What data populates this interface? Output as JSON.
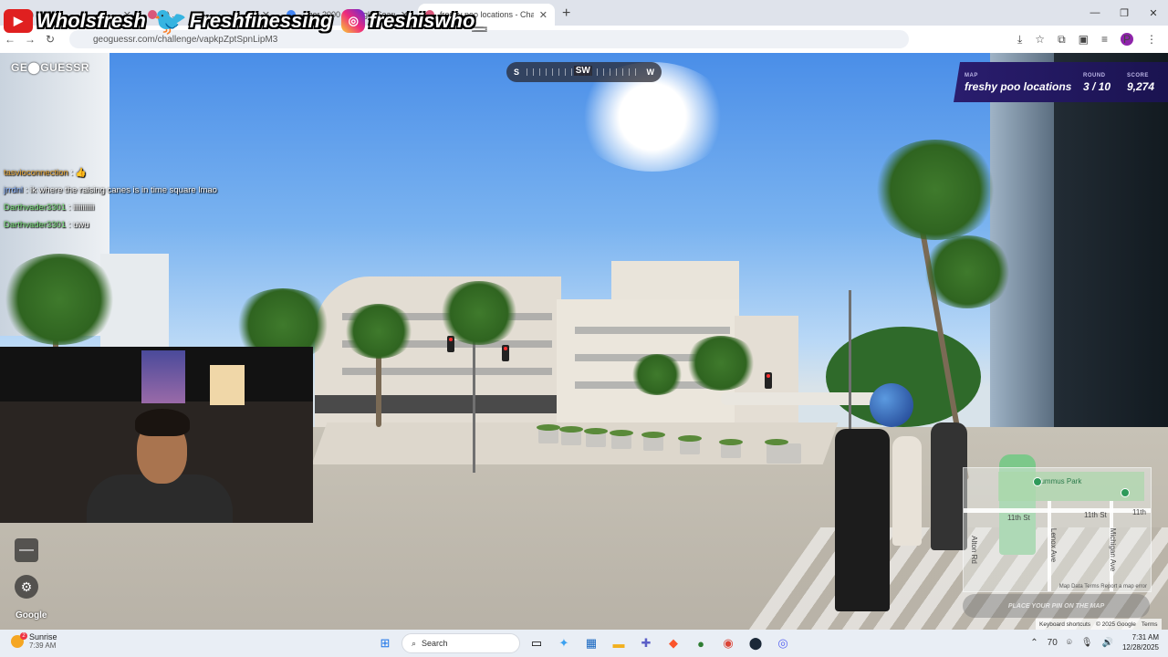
{
  "browser": {
    "tabs": [
      {
        "title": "(2) ..."
      },
      {
        "title": "2) ..."
      },
      {
        "title": "...ger 2000 - Google Search"
      },
      {
        "title": "freshy poo locations - Challeng"
      }
    ],
    "url": "geoguessr.com/challenge/vapkpZptSpnLipM3",
    "window_controls": [
      "—",
      "❐",
      "✕"
    ]
  },
  "socials": {
    "youtube": "WhoIsfresh",
    "twitter": "Freshfinessing",
    "instagram": "freshiswho_"
  },
  "geoguessr": {
    "logo": "GE⬤GUESSR",
    "compass": {
      "left": "S",
      "center": "SW",
      "right": "W"
    },
    "status": {
      "map_label": "MAP",
      "map_value": "freshy poo locations",
      "round_label": "ROUND",
      "round_value": "3 / 10",
      "score_label": "SCORE",
      "score_value": "9,274"
    },
    "zoom_out": "—",
    "settings_icon": "⚙",
    "google_watermark": "Google",
    "minimap": {
      "park": "Lummus Park",
      "street1": "11th St",
      "street2": "11th St",
      "street3": "11th",
      "street4": "Lenox Ave",
      "street5": "Michigan Ave",
      "street6": "Alton Rd",
      "credits": "Map Data   Terms   Report a map error"
    },
    "guess_button": "PLACE YOUR PIN ON THE MAP",
    "map_footer": {
      "shortcuts": "Keyboard shortcuts",
      "data": "© 2025 Google",
      "terms": "Terms"
    }
  },
  "chat": [
    {
      "user": "tasvioconnection",
      "msg": "👍"
    },
    {
      "user": "jrrdnl",
      "msg": "ik where the raising canes is in time square lmao"
    },
    {
      "user": "Darthvader3301",
      "msg": "iiiiiiiiiii"
    },
    {
      "user": "Darthvader3301",
      "msg": "uwu"
    }
  ],
  "taskbar": {
    "weather_title": "Sunrise",
    "weather_sub": "7:39 AM",
    "weather_badge": "2",
    "search": "Search",
    "time": "7:31 AM",
    "date": "12/28/2025",
    "tray_temp": "70"
  }
}
